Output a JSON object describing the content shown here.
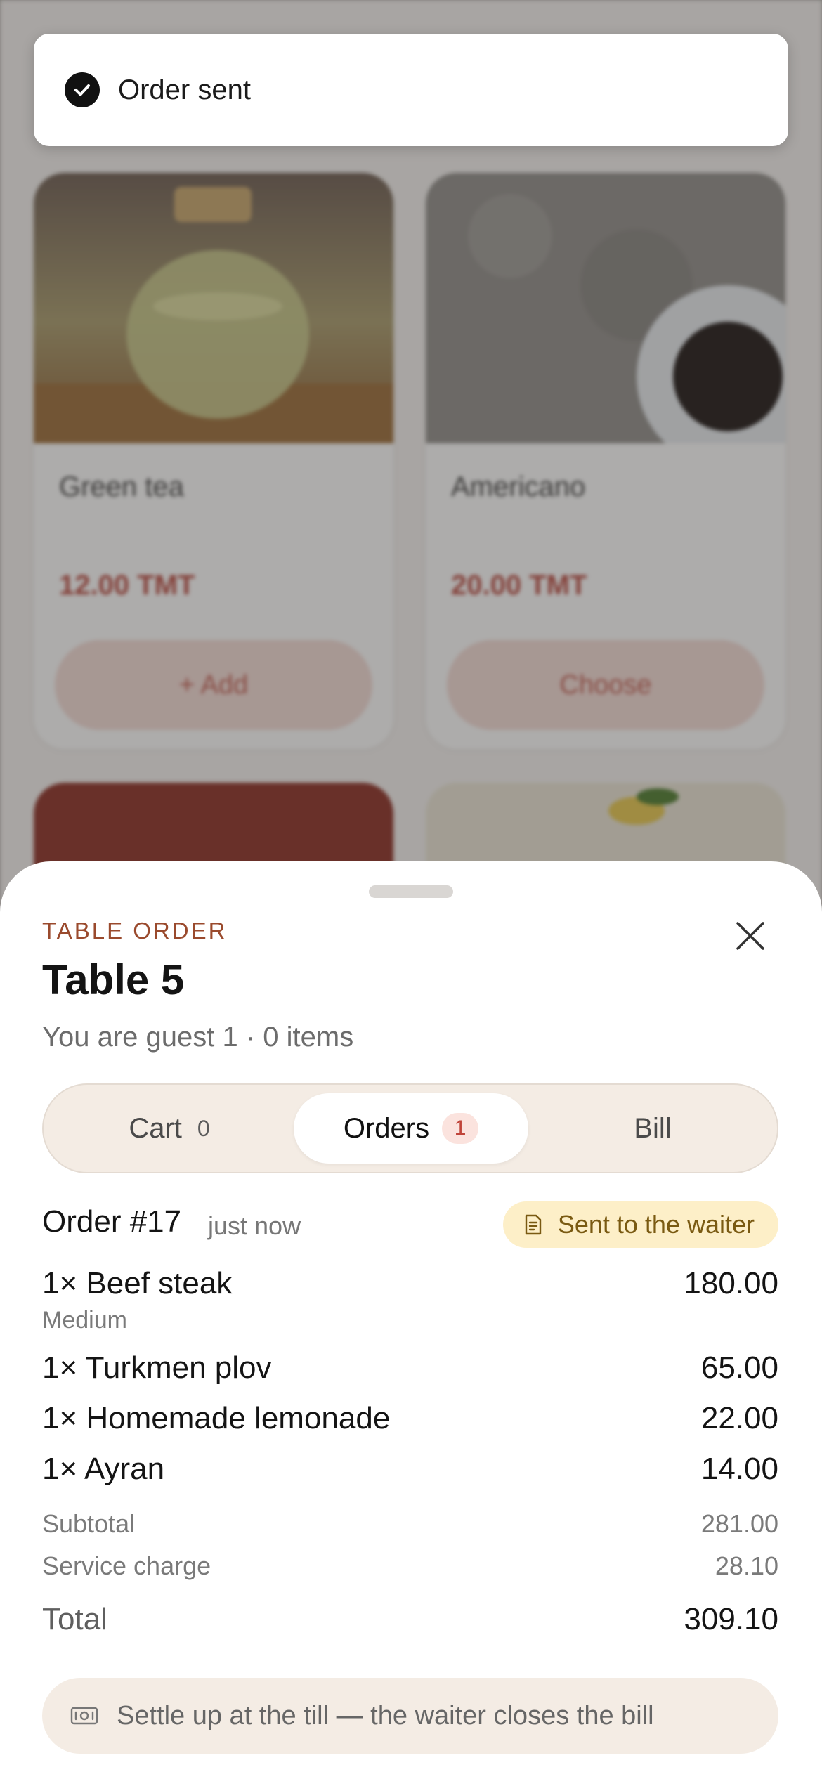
{
  "toast": {
    "message": "Order sent"
  },
  "menu": {
    "cards": [
      {
        "name": "Green tea",
        "price": "12.00 TMT",
        "action": "+ Add"
      },
      {
        "name": "Americano",
        "price": "20.00 TMT",
        "action": "Choose"
      }
    ]
  },
  "sheet": {
    "eyebrow": "TABLE ORDER",
    "title": "Table 5",
    "subtitle": "You are guest 1 · 0 items",
    "tabs": [
      {
        "label": "Cart",
        "count": "0"
      },
      {
        "label": "Orders",
        "count": "1"
      },
      {
        "label": "Bill"
      }
    ],
    "active_tab": "Orders",
    "order": {
      "number": "Order #17",
      "time": "just now",
      "status": "Sent to the waiter",
      "items": [
        {
          "qty": "1×",
          "name": "Beef steak",
          "modifier": "Medium",
          "amount": "180.00"
        },
        {
          "qty": "1×",
          "name": "Turkmen plov",
          "amount": "65.00"
        },
        {
          "qty": "1×",
          "name": "Homemade lemonade",
          "amount": "22.00"
        },
        {
          "qty": "1×",
          "name": "Ayran",
          "amount": "14.00"
        }
      ],
      "subtotal_label": "Subtotal",
      "subtotal": "281.00",
      "service_label": "Service charge",
      "service": "28.10",
      "total_label": "Total",
      "total": "309.10"
    },
    "note": "Settle up at the till — the waiter closes the bill"
  },
  "colors": {
    "accent": "#c0443a",
    "status_bg": "#fdefc8",
    "tab_bg": "#f4ece4"
  }
}
